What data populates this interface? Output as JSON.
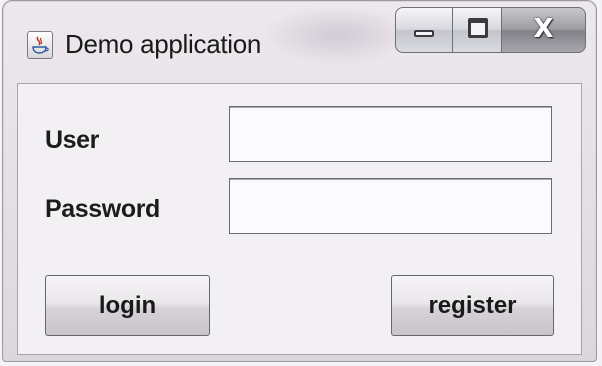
{
  "window": {
    "title": "Demo application",
    "icon": "java-app-icon",
    "controls": {
      "minimize": "minimize-icon",
      "maximize": "maximize-icon",
      "close_glyph": "X"
    }
  },
  "form": {
    "user_label": "User",
    "user_value": "",
    "password_label": "Password",
    "password_value": "",
    "login_label": "login",
    "register_label": "register"
  }
}
